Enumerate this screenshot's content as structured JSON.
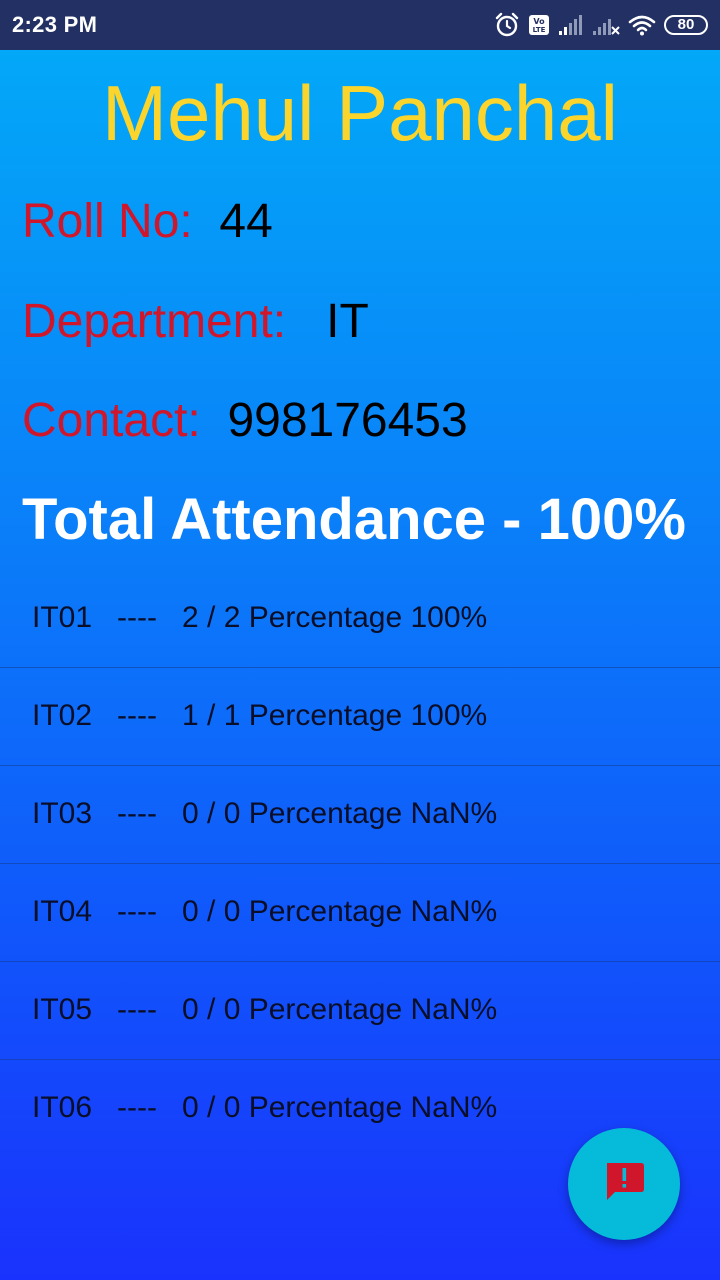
{
  "status_bar": {
    "time": "2:23 PM",
    "battery_level": "80",
    "icons": [
      "alarm-icon",
      "volte-icon",
      "signal-icon",
      "signal-no-service-icon",
      "wifi-icon",
      "battery-icon"
    ]
  },
  "student": {
    "name": "Mehul Panchal",
    "roll_label": "Roll No:",
    "roll_value": "44",
    "department_label": "Department:",
    "department_value": "IT",
    "contact_label": "Contact:",
    "contact_value": "998176453"
  },
  "attendance": {
    "total_text": "Total Attendance - 100%"
  },
  "subjects": [
    {
      "text": "IT01   ----   2 / 2 Percentage 100%"
    },
    {
      "text": "IT02   ----   1 / 1 Percentage 100%"
    },
    {
      "text": "IT03   ----   0 / 0 Percentage NaN%"
    },
    {
      "text": "IT04   ----   0 / 0 Percentage NaN%"
    },
    {
      "text": "IT05   ----   0 / 0 Percentage NaN%"
    },
    {
      "text": "IT06   ----   0 / 0 Percentage NaN%"
    }
  ],
  "fab": {
    "icon": "report-icon",
    "background_color": "#06bad9",
    "icon_color": "#d0162a"
  },
  "colors": {
    "name": "#fcd52c",
    "label": "#d0162a",
    "status_bar": "#223063"
  }
}
